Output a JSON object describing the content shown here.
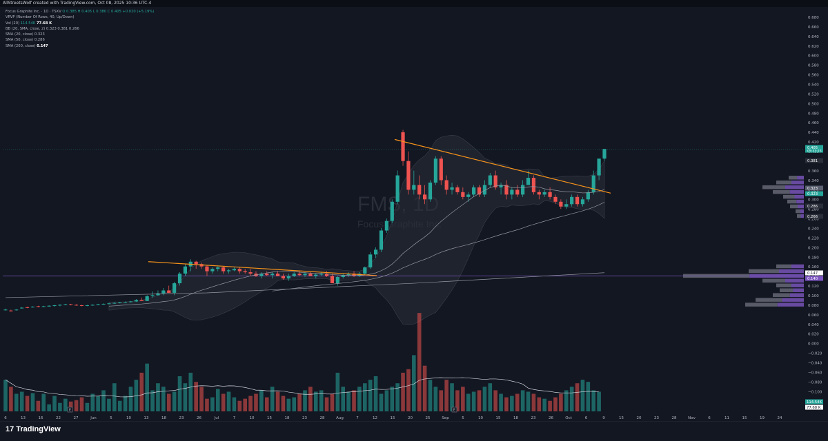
{
  "header": {
    "caption": "AllStreetsWolf created with TradingView.com, Oct 08, 2025 10:36 UTC-4"
  },
  "branding": {
    "logo_text": "TradingView",
    "logo_icon": "tradingview-logo-icon"
  },
  "watermark": {
    "symbol": "FMS, 1D",
    "name": "Focus Graphite Inc."
  },
  "legend": {
    "title": "Focus Graphite Inc. · 1D · TSXV",
    "ohlc": "O 0.385  H 0.405  L 0.380  C 0.405  +0.020 (+5.19%)",
    "vrvp": "VRVP (Number Of Rows, 40, Up/Down)",
    "vol_label": "Vol (20)",
    "vol_values": "114.54K",
    "vol_last": "77.68 K",
    "bb": "BB (20, SMA, close, 2)  0.323  0.381  0.266",
    "sma20": "SMA (20, close)  0.323",
    "sma50": "SMA (50, close)  0.286",
    "sma200_label": "SMA (200, close)",
    "sma200_value": "0.147"
  },
  "colors": {
    "background": "#131722",
    "up": "#26a69a",
    "down": "#ef5350",
    "trendline": "#f7931a",
    "vrvp_up": "#7e57c2",
    "vrvp_down": "#787b86",
    "sma": "#9598a1",
    "bb_fill": "#2a2e39"
  },
  "chart_data": {
    "type": "candlestick",
    "symbol": "FMS",
    "interval": "1D",
    "y_axis_ticks": [
      "0.680",
      "0.660",
      "0.640",
      "0.620",
      "0.600",
      "0.580",
      "0.560",
      "0.540",
      "0.520",
      "0.500",
      "0.480",
      "0.460",
      "0.440",
      "0.420",
      "0.400",
      "0.380",
      "0.360",
      "0.340",
      "0.320",
      "0.300",
      "0.280",
      "0.260",
      "0.240",
      "0.220",
      "0.200",
      "0.180",
      "0.160",
      "0.140",
      "0.120",
      "0.100",
      "0.080",
      "0.060",
      "0.040",
      "0.020",
      "0.000",
      "−0.020",
      "−0.040",
      "−0.060",
      "−0.080",
      "−0.100"
    ],
    "y_range": [
      -0.11,
      0.69
    ],
    "x_axis_ticks": [
      "6",
      "13",
      "16",
      "22",
      "27",
      "Jun",
      "5",
      "10",
      "13",
      "18",
      "23",
      "26",
      "Jul",
      "7",
      "10",
      "15",
      "18",
      "23",
      "28",
      "Aug",
      "7",
      "12",
      "15",
      "20",
      "25",
      "Sep",
      "5",
      "10",
      "15",
      "18",
      "23",
      "26",
      "Oct",
      "6",
      "9",
      "15",
      "20",
      "23",
      "28",
      "Nov",
      "6",
      "11",
      "15",
      "19",
      "24"
    ],
    "price_labels": [
      {
        "value": "0.405",
        "sub": "05:33:23",
        "kind": "last"
      },
      {
        "value": "0.381",
        "kind": "bb_upper"
      },
      {
        "value": "0.323",
        "kind": "sma20"
      },
      {
        "value": "0.323",
        "kind": "bb_basis"
      },
      {
        "value": "0.286",
        "kind": "sma50"
      },
      {
        "value": "0.266",
        "kind": "bb_lower"
      },
      {
        "value": "0.147",
        "kind": "sma200"
      },
      {
        "value": "0.140",
        "kind": "poc"
      }
    ],
    "volume_labels": [
      "114.54K",
      "77.68 K"
    ],
    "series": [
      {
        "name": "Price",
        "ohlc": [
          [
            0.07,
            0.072,
            0.068,
            0.07
          ],
          [
            0.068,
            0.07,
            0.066,
            0.067
          ],
          [
            0.07,
            0.071,
            0.068,
            0.07
          ],
          [
            0.074,
            0.075,
            0.072,
            0.074
          ],
          [
            0.075,
            0.076,
            0.073,
            0.074
          ],
          [
            0.075,
            0.077,
            0.074,
            0.076
          ],
          [
            0.077,
            0.078,
            0.075,
            0.076
          ],
          [
            0.076,
            0.078,
            0.075,
            0.077
          ],
          [
            0.077,
            0.079,
            0.076,
            0.078
          ],
          [
            0.078,
            0.08,
            0.076,
            0.079
          ],
          [
            0.079,
            0.081,
            0.077,
            0.08
          ],
          [
            0.08,
            0.082,
            0.079,
            0.081
          ],
          [
            0.081,
            0.082,
            0.079,
            0.08
          ],
          [
            0.08,
            0.081,
            0.078,
            0.079
          ],
          [
            0.079,
            0.08,
            0.077,
            0.078
          ],
          [
            0.078,
            0.08,
            0.077,
            0.079
          ],
          [
            0.079,
            0.081,
            0.078,
            0.08
          ],
          [
            0.08,
            0.082,
            0.079,
            0.081
          ],
          [
            0.081,
            0.083,
            0.08,
            0.082
          ],
          [
            0.082,
            0.084,
            0.081,
            0.083
          ],
          [
            0.083,
            0.085,
            0.082,
            0.084
          ],
          [
            0.084,
            0.086,
            0.083,
            0.085
          ],
          [
            0.085,
            0.087,
            0.084,
            0.086
          ],
          [
            0.086,
            0.088,
            0.085,
            0.087
          ],
          [
            0.087,
            0.092,
            0.086,
            0.09
          ],
          [
            0.09,
            0.095,
            0.088,
            0.088
          ],
          [
            0.088,
            0.1,
            0.088,
            0.098
          ],
          [
            0.098,
            0.108,
            0.095,
            0.1
          ],
          [
            0.1,
            0.11,
            0.099,
            0.104
          ],
          [
            0.104,
            0.115,
            0.1,
            0.11
          ],
          [
            0.11,
            0.12,
            0.105,
            0.105
          ],
          [
            0.105,
            0.128,
            0.1,
            0.125
          ],
          [
            0.125,
            0.148,
            0.12,
            0.145
          ],
          [
            0.145,
            0.165,
            0.14,
            0.16
          ],
          [
            0.16,
            0.175,
            0.15,
            0.17
          ],
          [
            0.17,
            0.172,
            0.155,
            0.165
          ],
          [
            0.165,
            0.168,
            0.155,
            0.16
          ],
          [
            0.16,
            0.162,
            0.14,
            0.15
          ],
          [
            0.15,
            0.158,
            0.145,
            0.155
          ],
          [
            0.155,
            0.16,
            0.15,
            0.158
          ],
          [
            0.158,
            0.16,
            0.145,
            0.15
          ],
          [
            0.15,
            0.155,
            0.145,
            0.152
          ],
          [
            0.152,
            0.158,
            0.15,
            0.155
          ],
          [
            0.155,
            0.158,
            0.145,
            0.15
          ],
          [
            0.15,
            0.155,
            0.145,
            0.148
          ],
          [
            0.148,
            0.155,
            0.14,
            0.145
          ],
          [
            0.145,
            0.15,
            0.138,
            0.14
          ],
          [
            0.14,
            0.148,
            0.135,
            0.145
          ],
          [
            0.145,
            0.15,
            0.14,
            0.142
          ],
          [
            0.142,
            0.148,
            0.135,
            0.145
          ],
          [
            0.145,
            0.15,
            0.14,
            0.14
          ],
          [
            0.14,
            0.145,
            0.132,
            0.135
          ],
          [
            0.135,
            0.145,
            0.13,
            0.14
          ],
          [
            0.14,
            0.148,
            0.138,
            0.145
          ],
          [
            0.145,
            0.15,
            0.14,
            0.142
          ],
          [
            0.142,
            0.148,
            0.138,
            0.145
          ],
          [
            0.145,
            0.15,
            0.14,
            0.14
          ],
          [
            0.14,
            0.145,
            0.135,
            0.143
          ],
          [
            0.143,
            0.148,
            0.14,
            0.145
          ],
          [
            0.145,
            0.15,
            0.138,
            0.14
          ],
          [
            0.14,
            0.145,
            0.13,
            0.125
          ],
          [
            0.125,
            0.14,
            0.12,
            0.138
          ],
          [
            0.138,
            0.145,
            0.135,
            0.142
          ],
          [
            0.142,
            0.148,
            0.138,
            0.145
          ],
          [
            0.145,
            0.15,
            0.138,
            0.14
          ],
          [
            0.14,
            0.148,
            0.138,
            0.145
          ],
          [
            0.145,
            0.16,
            0.143,
            0.158
          ],
          [
            0.158,
            0.19,
            0.155,
            0.185
          ],
          [
            0.185,
            0.2,
            0.178,
            0.195
          ],
          [
            0.195,
            0.24,
            0.19,
            0.235
          ],
          [
            0.235,
            0.26,
            0.23,
            0.255
          ],
          [
            0.255,
            0.3,
            0.25,
            0.295
          ],
          [
            0.295,
            0.36,
            0.29,
            0.35
          ],
          [
            0.44,
            0.445,
            0.37,
            0.38
          ],
          [
            0.38,
            0.4,
            0.31,
            0.32
          ],
          [
            0.32,
            0.36,
            0.31,
            0.33
          ],
          [
            0.33,
            0.35,
            0.3,
            0.31
          ],
          [
            0.31,
            0.33,
            0.29,
            0.3
          ],
          [
            0.3,
            0.34,
            0.295,
            0.335
          ],
          [
            0.335,
            0.39,
            0.33,
            0.385
          ],
          [
            0.385,
            0.39,
            0.33,
            0.34
          ],
          [
            0.34,
            0.35,
            0.31,
            0.32
          ],
          [
            0.32,
            0.335,
            0.31,
            0.325
          ],
          [
            0.325,
            0.33,
            0.31,
            0.315
          ],
          [
            0.315,
            0.325,
            0.3,
            0.305
          ],
          [
            0.305,
            0.315,
            0.295,
            0.31
          ],
          [
            0.31,
            0.33,
            0.305,
            0.325
          ],
          [
            0.325,
            0.33,
            0.305,
            0.31
          ],
          [
            0.31,
            0.34,
            0.305,
            0.33
          ],
          [
            0.33,
            0.355,
            0.325,
            0.35
          ],
          [
            0.35,
            0.36,
            0.32,
            0.325
          ],
          [
            0.325,
            0.335,
            0.31,
            0.33
          ],
          [
            0.33,
            0.34,
            0.3,
            0.31
          ],
          [
            0.31,
            0.325,
            0.3,
            0.32
          ],
          [
            0.32,
            0.33,
            0.305,
            0.31
          ],
          [
            0.31,
            0.34,
            0.305,
            0.33
          ],
          [
            0.33,
            0.36,
            0.33,
            0.345
          ],
          [
            0.345,
            0.35,
            0.31,
            0.315
          ],
          [
            0.315,
            0.32,
            0.3,
            0.31
          ],
          [
            0.31,
            0.32,
            0.305,
            0.315
          ],
          [
            0.315,
            0.325,
            0.3,
            0.305
          ],
          [
            0.305,
            0.31,
            0.29,
            0.295
          ],
          [
            0.295,
            0.3,
            0.28,
            0.285
          ],
          [
            0.285,
            0.3,
            0.28,
            0.29
          ],
          [
            0.29,
            0.31,
            0.285,
            0.305
          ],
          [
            0.305,
            0.31,
            0.285,
            0.29
          ],
          [
            0.29,
            0.305,
            0.285,
            0.3
          ],
          [
            0.3,
            0.32,
            0.295,
            0.315
          ],
          [
            0.315,
            0.36,
            0.31,
            0.35
          ],
          [
            0.35,
            0.385,
            0.34,
            0.385
          ],
          [
            0.385,
            0.405,
            0.38,
            0.405
          ]
        ]
      },
      {
        "name": "Volume",
        "values": [
          45,
          35,
          25,
          28,
          22,
          26,
          15,
          25,
          10,
          22,
          12,
          18,
          14,
          16,
          20,
          12,
          25,
          22,
          30,
          18,
          40,
          15,
          22,
          35,
          45,
          55,
          68,
          30,
          40,
          35,
          25,
          28,
          50,
          40,
          55,
          42,
          35,
          18,
          20,
          32,
          25,
          28,
          20,
          15,
          18,
          22,
          25,
          30,
          20,
          35,
          28,
          22,
          18,
          20,
          25,
          30,
          35,
          28,
          30,
          20,
          25,
          55,
          35,
          28,
          30,
          35,
          40,
          45,
          50,
          25,
          30,
          35,
          40,
          55,
          60,
          80,
          140,
          65,
          45,
          35,
          30,
          45,
          40,
          30,
          35,
          25,
          28,
          30,
          35,
          40,
          30,
          25,
          20,
          22,
          25,
          30,
          28,
          25,
          20,
          18,
          15,
          20,
          25,
          30,
          35,
          40,
          45,
          42,
          30,
          28
        ]
      }
    ]
  }
}
